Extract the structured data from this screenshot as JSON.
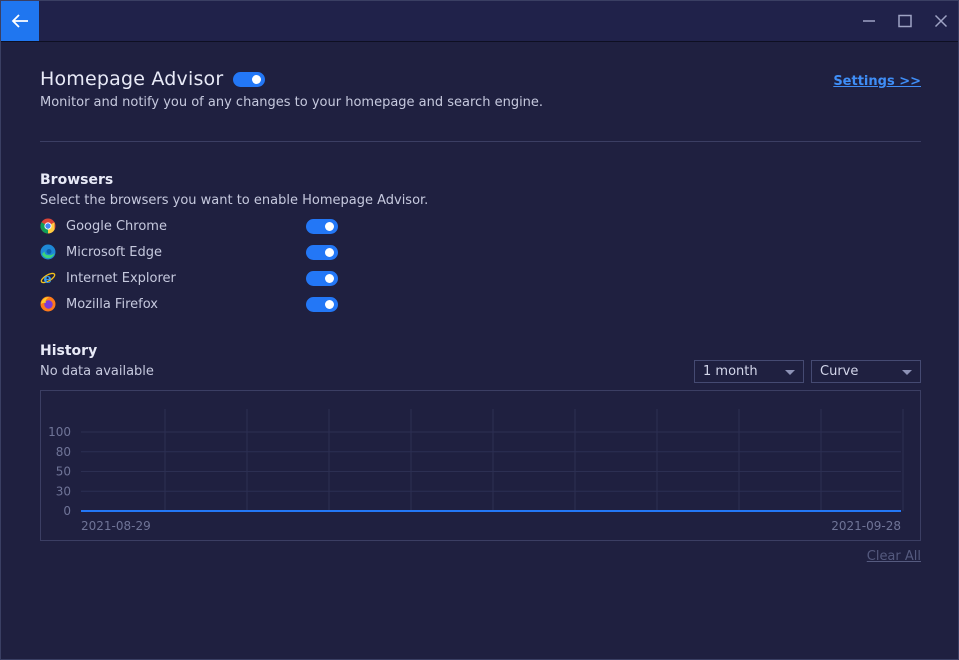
{
  "window": {
    "controls": [
      "minimize-icon",
      "maximize-icon",
      "close-icon"
    ]
  },
  "header": {
    "title": "Homepage Advisor",
    "enabled": true,
    "subtitle": "Monitor and notify you of any changes to your homepage and search engine.",
    "settings_link": "Settings >>"
  },
  "browsers": {
    "title": "Browsers",
    "description": "Select the browsers you want to enable Homepage Advisor.",
    "items": [
      {
        "label": "Google Chrome",
        "icon": "chrome-icon",
        "enabled": true
      },
      {
        "label": "Microsoft Edge",
        "icon": "edge-icon",
        "enabled": true
      },
      {
        "label": "Internet Explorer",
        "icon": "ie-icon",
        "enabled": true
      },
      {
        "label": "Mozilla Firefox",
        "icon": "firefox-icon",
        "enabled": true
      }
    ]
  },
  "history": {
    "title": "History",
    "status": "No data available",
    "period_select": "1 month",
    "style_select": "Curve",
    "clear_all": "Clear All"
  },
  "chart_data": {
    "type": "line",
    "x": [
      "2021-08-29",
      "2021-09-28"
    ],
    "series": [
      {
        "values": [
          0,
          0
        ]
      }
    ],
    "yticks": [
      0,
      30,
      50,
      80,
      100
    ],
    "ylim": [
      0,
      100
    ],
    "grid": true,
    "color": "#2377f6"
  },
  "colors": {
    "accent": "#2377f6",
    "background": "#1f2040"
  }
}
